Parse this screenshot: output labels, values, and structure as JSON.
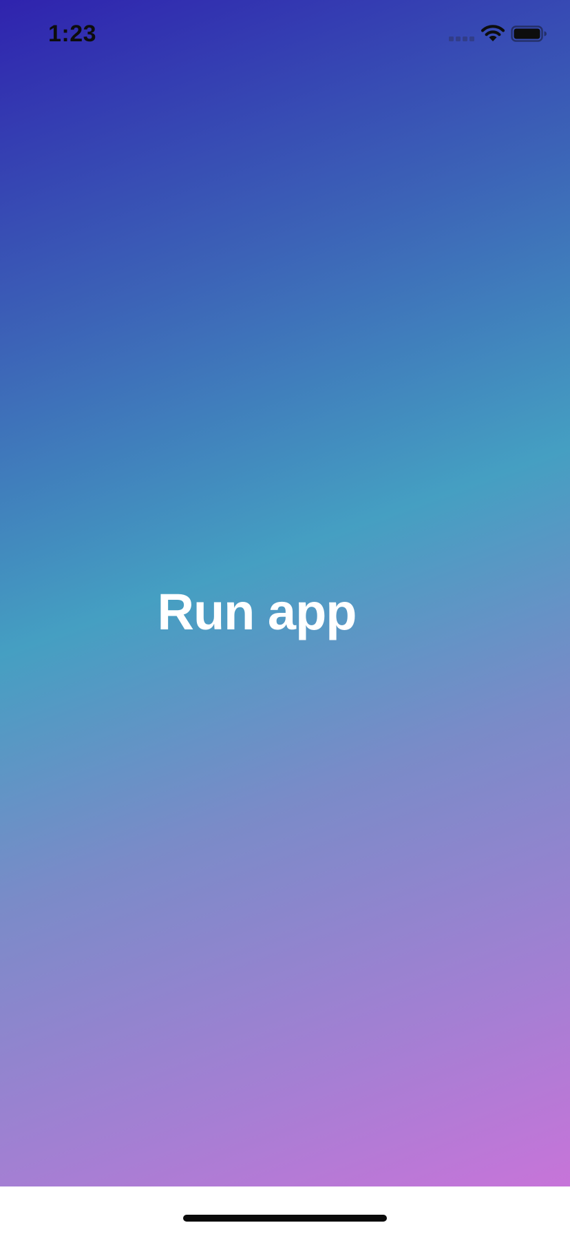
{
  "status_bar": {
    "time": "1:23",
    "signal_icon": "cellular-signal-icon",
    "wifi_icon": "wifi-icon",
    "battery_icon": "battery-full-icon"
  },
  "main": {
    "label": "Run app"
  },
  "colors": {
    "gradient_start": "#2f23ae",
    "gradient_mid": "#459fc2",
    "gradient_end": "#c774d9",
    "label_color": "#ffffff"
  }
}
